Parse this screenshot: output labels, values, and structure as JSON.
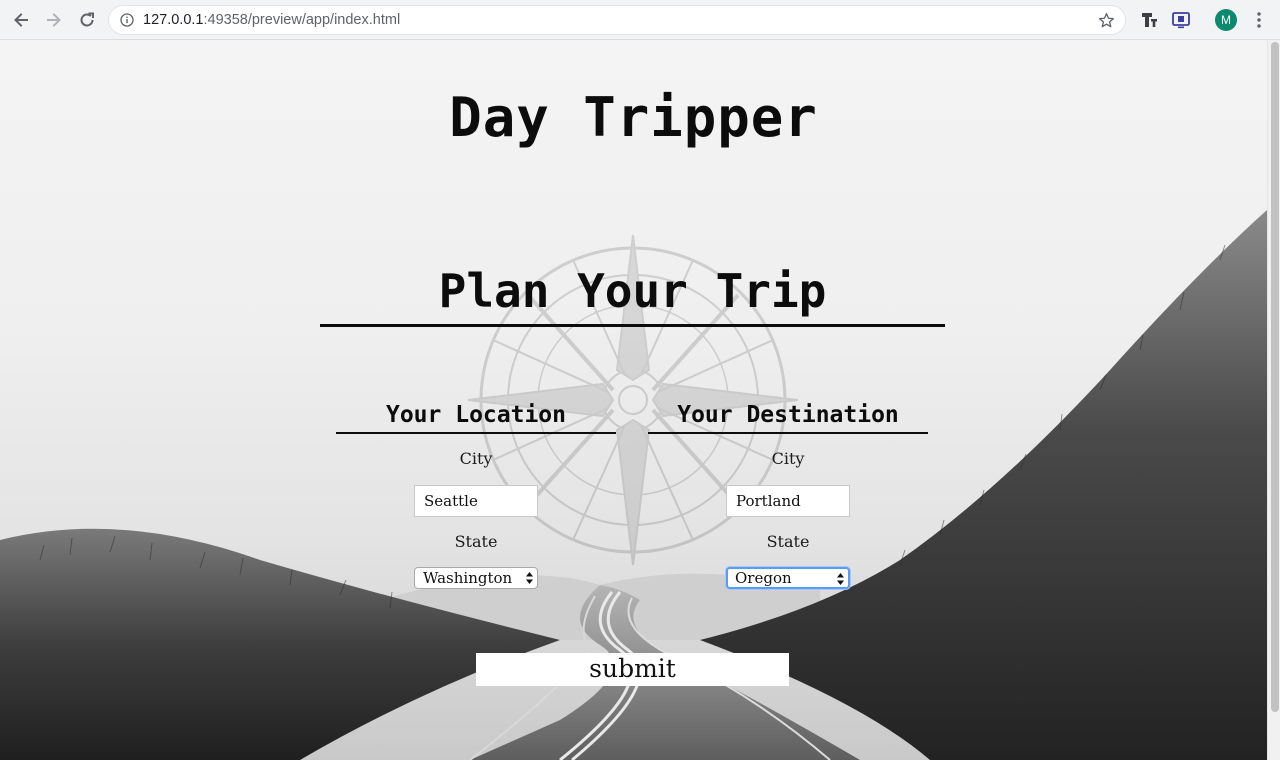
{
  "browser": {
    "url_host": "127.0.0.1",
    "url_path": ":49358/preview/app/index.html",
    "avatar_initial": "M",
    "icons": [
      "back-icon",
      "forward-icon",
      "reload-icon",
      "info-icon",
      "star-icon",
      "text-extension-icon",
      "cast-extension-icon",
      "menu-icon"
    ]
  },
  "page": {
    "title": "Day Tripper",
    "section_title": "Plan Your Trip",
    "location": {
      "heading": "Your Location",
      "city_label": "City",
      "city_value": "Seattle",
      "state_label": "State",
      "state_value": "Washington"
    },
    "destination": {
      "heading": "Your Destination",
      "city_label": "City",
      "city_value": "Portland",
      "state_label": "State",
      "state_value": "Oregon"
    },
    "submit_label": "submit"
  },
  "colors": {
    "text": "#0c0c0c",
    "focus_ring": "#5b9cf0",
    "avatar": "#0b8a6d"
  }
}
